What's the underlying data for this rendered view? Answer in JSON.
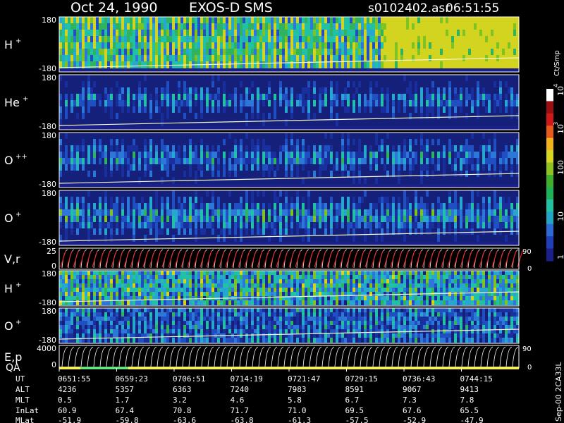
{
  "header": {
    "date": "Oct 24, 1990",
    "instrument": "EXOS-D SMS",
    "file": "s0102402.asr",
    "time": "06:51:55"
  },
  "colorbar": {
    "unit": "Ct/Smp",
    "ticks": [
      "1",
      "10",
      "100",
      "10",
      "10"
    ],
    "tick_exponents": [
      "",
      "",
      "",
      "3",
      "4"
    ],
    "colors": [
      "#1a1f8c",
      "#1f3fb8",
      "#2c6bd6",
      "#22a6c8",
      "#1fc1a0",
      "#1fb15a",
      "#3fae2a",
      "#8fc21f",
      "#d6d61f",
      "#f2b21a",
      "#e85a1a",
      "#d01818",
      "#9a1010",
      "#ffffff"
    ]
  },
  "footer_label": "Sep-00 2CA33L",
  "chart_data": [
    {
      "type": "heatmap",
      "panel": "H+",
      "label": "H",
      "superscript": "+",
      "ylim": [
        -180,
        180
      ],
      "ytick_top": "180",
      "ytick_bottom": "-180"
    },
    {
      "type": "heatmap",
      "panel": "He+",
      "label": "He",
      "superscript": "+",
      "ylim": [
        -180,
        180
      ],
      "ytick_top": "180",
      "ytick_bottom": "-180"
    },
    {
      "type": "heatmap",
      "panel": "O++",
      "label": "O",
      "superscript": "++",
      "ylim": [
        -180,
        180
      ],
      "ytick_top": "180",
      "ytick_bottom": "-180"
    },
    {
      "type": "heatmap",
      "panel": "O+",
      "label": "O",
      "superscript": "+",
      "ylim": [
        -180,
        180
      ],
      "ytick_top": "180",
      "ytick_bottom": "-180"
    },
    {
      "type": "line",
      "panel": "V,r",
      "label": "V,r",
      "ytick_top": "25",
      "ytick_bottom": "0",
      "right_ticks": [
        "90",
        "0"
      ]
    },
    {
      "type": "heatmap",
      "panel": "H+ (2)",
      "label": "H",
      "superscript": "+",
      "ylim": [
        -180,
        180
      ],
      "ytick_top": "180",
      "ytick_bottom": "-180"
    },
    {
      "type": "heatmap",
      "panel": "O+ (2)",
      "label": "O",
      "superscript": "+",
      "ylim": [
        -180,
        180
      ],
      "ytick_top": "180",
      "ytick_bottom": "-180"
    },
    {
      "type": "line",
      "panel": "E,p",
      "label": "E,p",
      "sublabel": "QA",
      "ytick_top": "4000",
      "ytick_bottom": "0",
      "right_ticks": [
        "90",
        "0"
      ]
    }
  ],
  "ephemeris": {
    "row_labels": [
      "UT",
      "ALT",
      "MLT",
      "InLat",
      "MLat"
    ],
    "columns": [
      [
        "0651:55",
        "4236",
        "0.5",
        "60.9",
        "-51.9"
      ],
      [
        "0659:23",
        "5357",
        "1.7",
        "67.4",
        "-59.8"
      ],
      [
        "0706:51",
        "6363",
        "3.2",
        "70.8",
        "-63.6"
      ],
      [
        "0714:19",
        "7240",
        "4.6",
        "71.7",
        "-63.8"
      ],
      [
        "0721:47",
        "7983",
        "5.8",
        "71.0",
        "-61.3"
      ],
      [
        "0729:15",
        "8591",
        "6.7",
        "69.5",
        "-57.5"
      ],
      [
        "0736:43",
        "9067",
        "7.3",
        "67.6",
        "-52.9"
      ],
      [
        "0744:15",
        "9413",
        "7.8",
        "65.5",
        "-47.9"
      ]
    ]
  }
}
